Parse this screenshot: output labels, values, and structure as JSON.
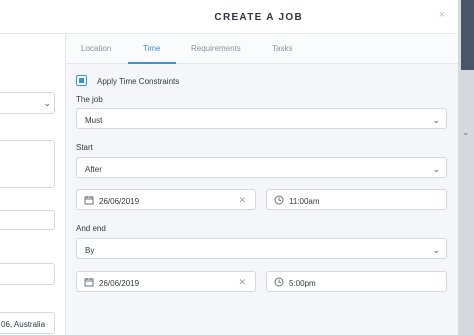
{
  "modal": {
    "title": "CREATE A JOB",
    "close": "×"
  },
  "tabs": [
    "Location",
    "Time",
    "Requirements",
    "Tasks"
  ],
  "active_tab": "Time",
  "time": {
    "apply_label": "Apply Time Constraints",
    "apply_checked": true,
    "the_job_label": "The job",
    "the_job_value": "Must",
    "start_label": "Start",
    "start_value": "After",
    "start_date": "26/06/2019",
    "start_time": "11:00am",
    "end_label": "And end",
    "end_value": "By",
    "end_date": "26/06/2019",
    "end_time": "5:00pm"
  },
  "left_pane": {
    "address_fragment": "06, Australia"
  },
  "colors": {
    "accent": "#3b93d6",
    "background": "#f4f6f9"
  }
}
